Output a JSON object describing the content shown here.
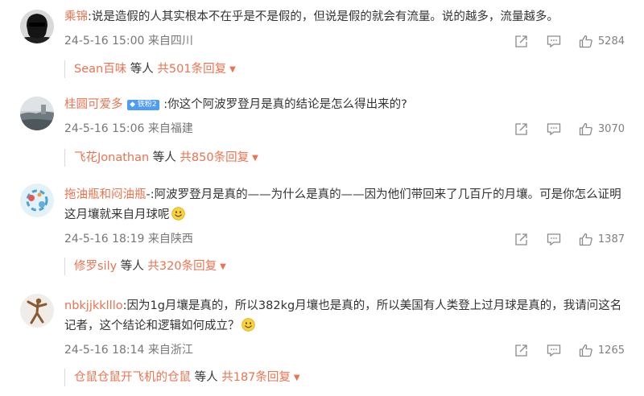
{
  "comments": [
    {
      "user": "乘锦",
      "text": ":说是造假的人其实根本不在乎是不是假的，但说是假的就会有流量。说的越多，流量越多。",
      "time": "24-5-16 15:00",
      "location": "来自四川",
      "likes": "5284",
      "reply_user": "Sean百味",
      "reply_mid": " 等人 ",
      "reply_count": "共501条回复"
    },
    {
      "user": "桂圆可爱多",
      "badge": "铁粉2",
      "text": " :你这个阿波罗登月是真的结论是怎么得出来的?",
      "time": "24-5-16 15:06",
      "location": "来自福建",
      "likes": "3070",
      "reply_user": "飞花Jonathan",
      "reply_mid": " 等人 ",
      "reply_count": "共850条回复"
    },
    {
      "user": "拖油瓶和闷油瓶",
      "text": "-:阿波罗登月是真的——为什么是真的——因为他们带回来了几百斤的月壤。可是你怎么证明这月壤就来自月球呢",
      "time": "24-5-16 18:19",
      "location": "来自陕西",
      "likes": "1387",
      "reply_user": "修罗sily",
      "reply_mid": " 等人 ",
      "reply_count": "共320条回复"
    },
    {
      "user": "nbkjjkklllo",
      "text": ":因为1g月壤是真的，所以382kg月壤也是真的，所以美国有人类登上过月球是真的，我请问这名记者，这个结论和逻辑如何成立？",
      "time": "24-5-16 18:14",
      "location": "来自浙江",
      "likes": "1265",
      "reply_user": "仓鼠仓鼠开飞机的仓鼠",
      "reply_mid": " 等人 ",
      "reply_count": "共187条回复"
    }
  ],
  "icons": {
    "share": "share-icon",
    "comment": "comment-icon",
    "like": "thumbs-up-icon",
    "caret": "caret-down-icon",
    "emoji": "smile-emoji-icon"
  },
  "colors": {
    "username": "#eb7350",
    "text": "#333333",
    "meta": "#777777",
    "badge": "#4e9cf5"
  }
}
